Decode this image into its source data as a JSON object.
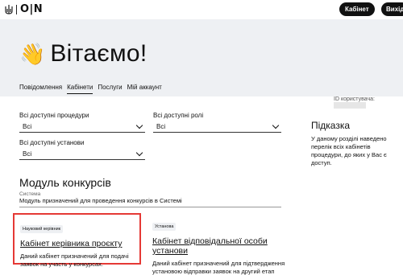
{
  "header": {
    "logo_text": "O|N",
    "cabinet_button": "Кабінет",
    "exit_button": "Вихід"
  },
  "hero": {
    "emoji": "👋",
    "title": "Вітаємо!",
    "tabs": [
      {
        "label": "Повідомлення",
        "active": false
      },
      {
        "label": "Кабінети",
        "active": true
      },
      {
        "label": "Послуги",
        "active": false
      },
      {
        "label": "Мій аккаунт",
        "active": false
      }
    ]
  },
  "user": {
    "id_label": "ID користувача:"
  },
  "filters": {
    "procedures": {
      "label": "Всі доступні процедури",
      "value": "Всі"
    },
    "roles": {
      "label": "Всі доступні ролі",
      "value": "Всі"
    },
    "institutions": {
      "label": "Всі доступні установи",
      "value": "Всі"
    }
  },
  "module": {
    "title": "Модуль конкурсів",
    "system_label": "Система",
    "system_value": "Модуль призначений для проведення конкурсів в Системі"
  },
  "cards": [
    {
      "badge": "Науковий керівник",
      "title": "Кабінет керівника проєкту",
      "description": "Даний кабінет призначений для подачі заявок на участь у конкурсах."
    },
    {
      "badge": "Установа",
      "title": "Кабінет відповідальної особи установи",
      "description": "Даний кабінет призначений для підтвердження установою відправки заявок на другий етап конкурсу"
    }
  ],
  "hint": {
    "title": "Підказка",
    "text": "У даному розділі наведено перелік всіх кабінетів процедури, до яких у Вас є доступ."
  }
}
